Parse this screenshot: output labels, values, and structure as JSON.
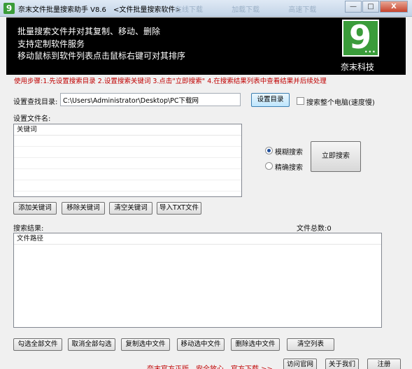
{
  "window": {
    "app_icon_glyph": "9",
    "title": "奈末文件批量搜索助手 V8.6",
    "subtitle": "<文件批量搜索软件>",
    "ghost_tabs": [
      "在线下载",
      "加载下载",
      "高速下载"
    ],
    "minimize": "—",
    "maximize": "□",
    "close": "X"
  },
  "banner": {
    "line1": "批量搜索文件并对其复制、移动、删除",
    "line2": "支持定制软件服务",
    "line3": "移动鼠标到软件列表点击鼠标右键可对其排序",
    "logo_glyph": "9",
    "logo_dots": "...",
    "logo_caption": "奈末科技"
  },
  "steps_text": "使用步骤:1.先设置搜索目录 2.设置搜索关键词 3.点击\"立即搜索\" 4.在搜索结果列表中查看结果并后续处理",
  "search_dir": {
    "label": "设置查找目录:",
    "value": "C:\\Users\\Administrator\\Desktop\\PC下载网",
    "set_button": "设置目录",
    "whole_pc_label": "搜索整个电脑(速度慢)"
  },
  "filename_section": {
    "label": "设置文件名:",
    "column_header": "关键词"
  },
  "mode": {
    "fuzzy_label": "模糊搜索",
    "exact_label": "精确搜索",
    "selected": "fuzzy"
  },
  "search_now_button": "立即搜索",
  "keyword_buttons": [
    "添加关键词",
    "移除关键词",
    "清空关键词",
    "导入TXT文件"
  ],
  "results": {
    "label": "搜索结果:",
    "count_label": "文件总数:",
    "count": "0",
    "column_header": "文件路径"
  },
  "result_buttons": [
    "勾选全部文件",
    "取消全部勾选",
    "复制选中文件",
    "移动选中文件",
    "删除选中文件",
    "清空列表"
  ],
  "footer": {
    "slogan": "奈末官方正版、安全放心、官方下载 >>",
    "visit_site": "访问官网",
    "about": "关于我们",
    "register": "注册"
  },
  "colors": {
    "banner_bg": "#000000",
    "logo_green": "#3a9c3a",
    "steps_red": "#c00000"
  }
}
